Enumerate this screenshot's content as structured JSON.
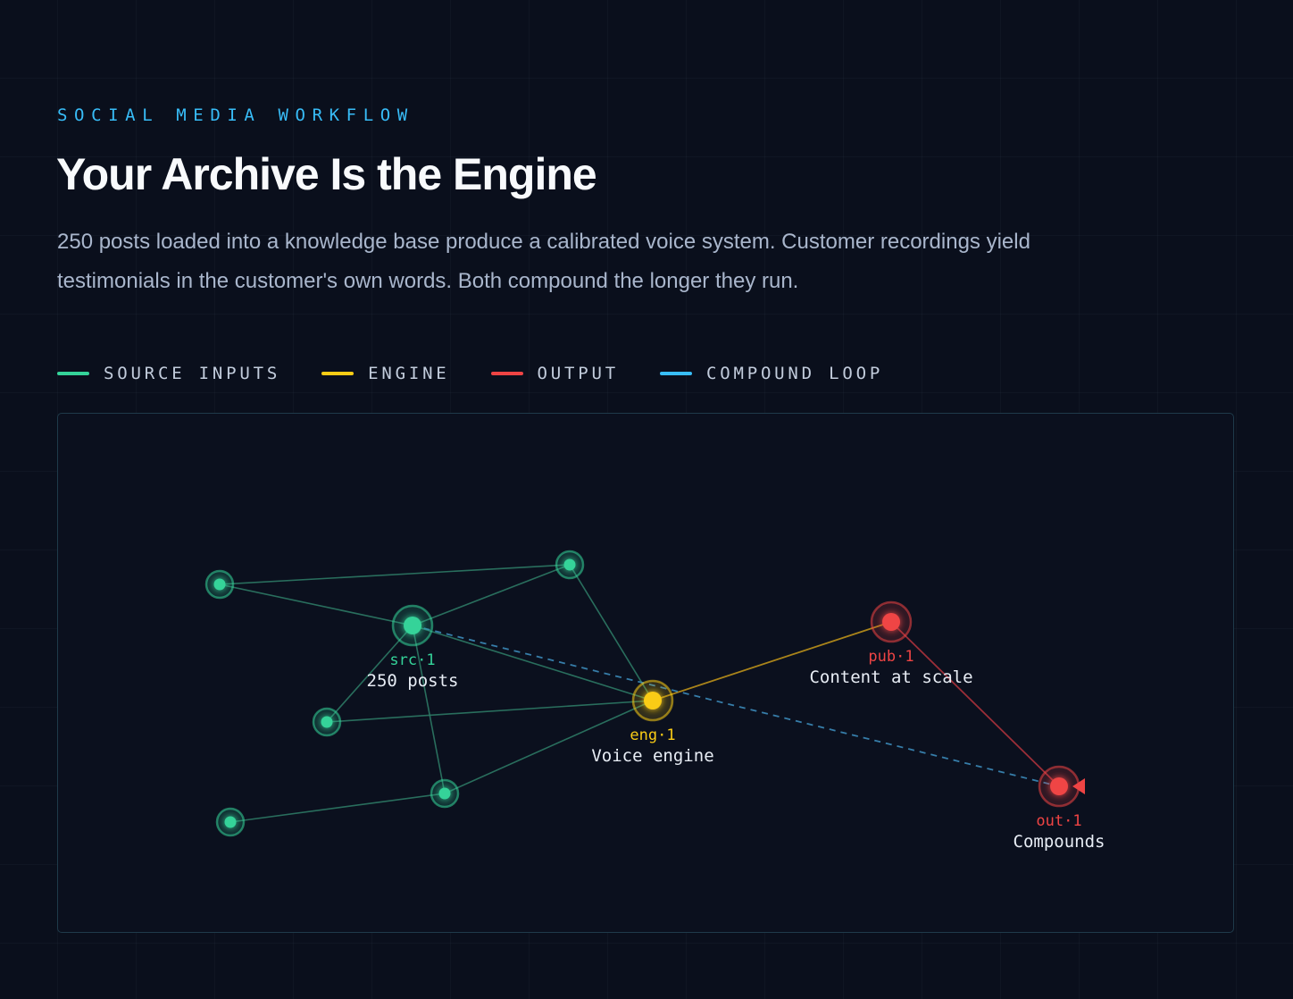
{
  "header": {
    "eyebrow": "SOCIAL MEDIA WORKFLOW",
    "title": "Your Archive Is the Engine",
    "description": "250 posts loaded into a knowledge base produce a calibrated voice system. Customer recordings yield testimonials in the customer's own words. Both compound the longer they run."
  },
  "legend": [
    {
      "label": "SOURCE INPUTS",
      "color": "#34d399"
    },
    {
      "label": "ENGINE",
      "color": "#facc15"
    },
    {
      "label": "OUTPUT",
      "color": "#ef4444"
    },
    {
      "label": "COMPOUND LOOP",
      "color": "#38bdf8"
    }
  ],
  "diagram": {
    "nodes": [
      {
        "key": "src1",
        "id": "src·1",
        "label": "250 posts",
        "kind": "source",
        "main": true
      },
      {
        "key": "eng1",
        "id": "eng·1",
        "label": "Voice engine",
        "kind": "engine",
        "main": true
      },
      {
        "key": "pub1",
        "id": "pub·1",
        "label": "Content at scale",
        "kind": "output",
        "main": true
      },
      {
        "key": "out1",
        "id": "out·1",
        "label": "Compounds",
        "kind": "output",
        "main": true
      },
      {
        "key": "s2",
        "id": "",
        "label": "",
        "kind": "source",
        "main": false
      },
      {
        "key": "s3",
        "id": "",
        "label": "",
        "kind": "source",
        "main": false
      },
      {
        "key": "s4",
        "id": "",
        "label": "",
        "kind": "source",
        "main": false
      },
      {
        "key": "s5",
        "id": "",
        "label": "",
        "kind": "source",
        "main": false
      },
      {
        "key": "s6",
        "id": "",
        "label": "",
        "kind": "source",
        "main": false
      }
    ],
    "edges": [
      {
        "from": "s2",
        "to": "s3",
        "kind": "source"
      },
      {
        "from": "s2",
        "to": "src1",
        "kind": "source"
      },
      {
        "from": "s3",
        "to": "src1",
        "kind": "source"
      },
      {
        "from": "s3",
        "to": "eng1",
        "kind": "source"
      },
      {
        "from": "src1",
        "to": "s4",
        "kind": "source"
      },
      {
        "from": "src1",
        "to": "s5",
        "kind": "source"
      },
      {
        "from": "src1",
        "to": "eng1",
        "kind": "source"
      },
      {
        "from": "s4",
        "to": "eng1",
        "kind": "source"
      },
      {
        "from": "s5",
        "to": "eng1",
        "kind": "source"
      },
      {
        "from": "s6",
        "to": "s5",
        "kind": "source"
      },
      {
        "from": "eng1",
        "to": "pub1",
        "kind": "engine"
      },
      {
        "from": "pub1",
        "to": "out1",
        "kind": "output"
      },
      {
        "from": "src1",
        "to": "out1",
        "kind": "loop"
      }
    ]
  }
}
